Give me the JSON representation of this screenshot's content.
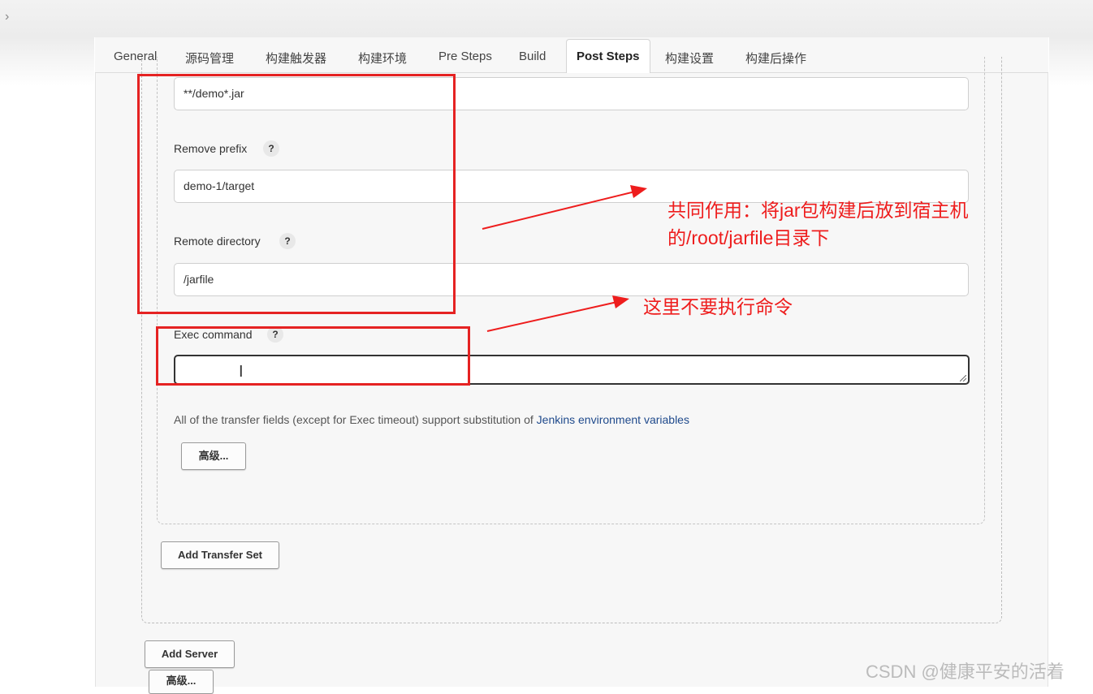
{
  "topbar": {
    "chevron": "›"
  },
  "tabs": [
    {
      "label": "General"
    },
    {
      "label": "源码管理"
    },
    {
      "label": "构建触发器"
    },
    {
      "label": "构建环境"
    },
    {
      "label": "Pre Steps"
    },
    {
      "label": "Build"
    },
    {
      "label": "Post Steps",
      "active": true
    },
    {
      "label": "构建设置"
    },
    {
      "label": "构建后操作"
    }
  ],
  "form": {
    "source_files_value": "**/demo*.jar",
    "remove_prefix": {
      "label": "Remove prefix",
      "value": "demo-1/target"
    },
    "remote_directory": {
      "label": "Remote directory",
      "value": "/jarfile"
    },
    "exec_command": {
      "label": "Exec command",
      "value": ""
    },
    "help_glyph": "?",
    "info_text": "All of the transfer fields (except for Exec timeout) support substitution of ",
    "info_link": "Jenkins environment variables",
    "advanced_button": "高级...",
    "add_transfer_set_button": "Add Transfer Set",
    "add_server_button": "Add Server",
    "advanced_button_2": "高级..."
  },
  "annotations": {
    "note1_line1": "共同作用：将jar包构建后放到宿主机",
    "note1_line2": "的/root/jarfile目录下",
    "note2": "这里不要执行命令",
    "color": "#ee1d1d"
  },
  "cursor_glyph": "I",
  "watermark": "CSDN @健康平安的活着"
}
